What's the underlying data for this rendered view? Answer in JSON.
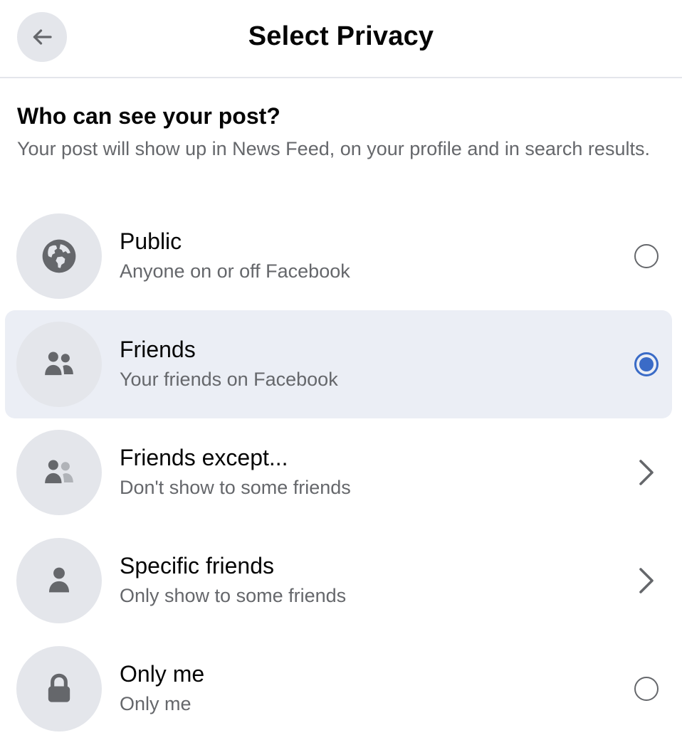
{
  "header": {
    "title": "Select Privacy",
    "back_icon": "arrow-left-icon"
  },
  "intro": {
    "heading": "Who can see your post?",
    "description": "Your post will show up in News Feed, on your profile and in search results."
  },
  "options": [
    {
      "label": "Public",
      "sublabel": "Anyone on or off Facebook",
      "icon": "globe-icon",
      "control": "radio",
      "selected": false
    },
    {
      "label": "Friends",
      "sublabel": "Your friends on Facebook",
      "icon": "friends-icon",
      "control": "radio",
      "selected": true
    },
    {
      "label": "Friends except...",
      "sublabel": "Don't show to some friends",
      "icon": "friends-except-icon",
      "control": "chevron",
      "selected": false
    },
    {
      "label": "Specific friends",
      "sublabel": "Only show to some friends",
      "icon": "person-icon",
      "control": "chevron",
      "selected": false
    },
    {
      "label": "Only me",
      "sublabel": "Only me",
      "icon": "lock-icon",
      "control": "radio",
      "selected": false
    }
  ],
  "colors": {
    "accent": "#3a6bc7",
    "selected_row_bg": "#ebeef5",
    "icon_circle_bg": "#e4e6eb",
    "secondary_text": "#65676b",
    "icon_fill": "#65676b"
  }
}
